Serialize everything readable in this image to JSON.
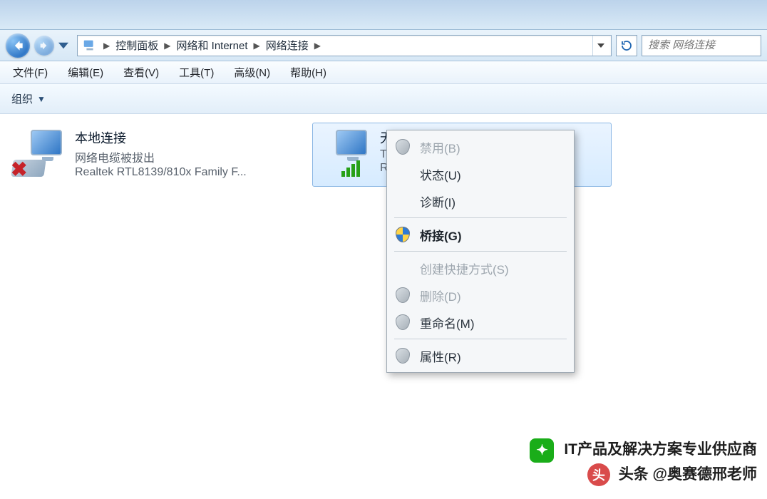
{
  "breadcrumb": {
    "item0": "控制面板",
    "item1": "网络和 Internet",
    "item2": "网络连接"
  },
  "search": {
    "placeholder": "搜索 网络连接"
  },
  "menu": {
    "file": "文件(F)",
    "edit": "编辑(E)",
    "view": "查看(V)",
    "tools": "工具(T)",
    "advanced": "高级(N)",
    "help": "帮助(H)"
  },
  "orgbar": {
    "organize": "组织"
  },
  "connections": {
    "lan": {
      "title": "本地连接",
      "status": "网络电缆被拔出",
      "adapter": "Realtek RTL8139/810x Family F..."
    },
    "wifi": {
      "title": "无线网络连接",
      "status_initial": "T",
      "adapter_initial": "R"
    }
  },
  "context_menu": {
    "disable": "禁用(B)",
    "status": "状态(U)",
    "diagnose": "诊断(I)",
    "bridge": "桥接(G)",
    "shortcut": "创建快捷方式(S)",
    "delete": "删除(D)",
    "rename": "重命名(M)",
    "props": "属性(R)"
  },
  "watermark": {
    "wechat_label": "IT产品及解决方案专业供应商",
    "toutiao_label": "头条 @奥赛德邢老师"
  }
}
